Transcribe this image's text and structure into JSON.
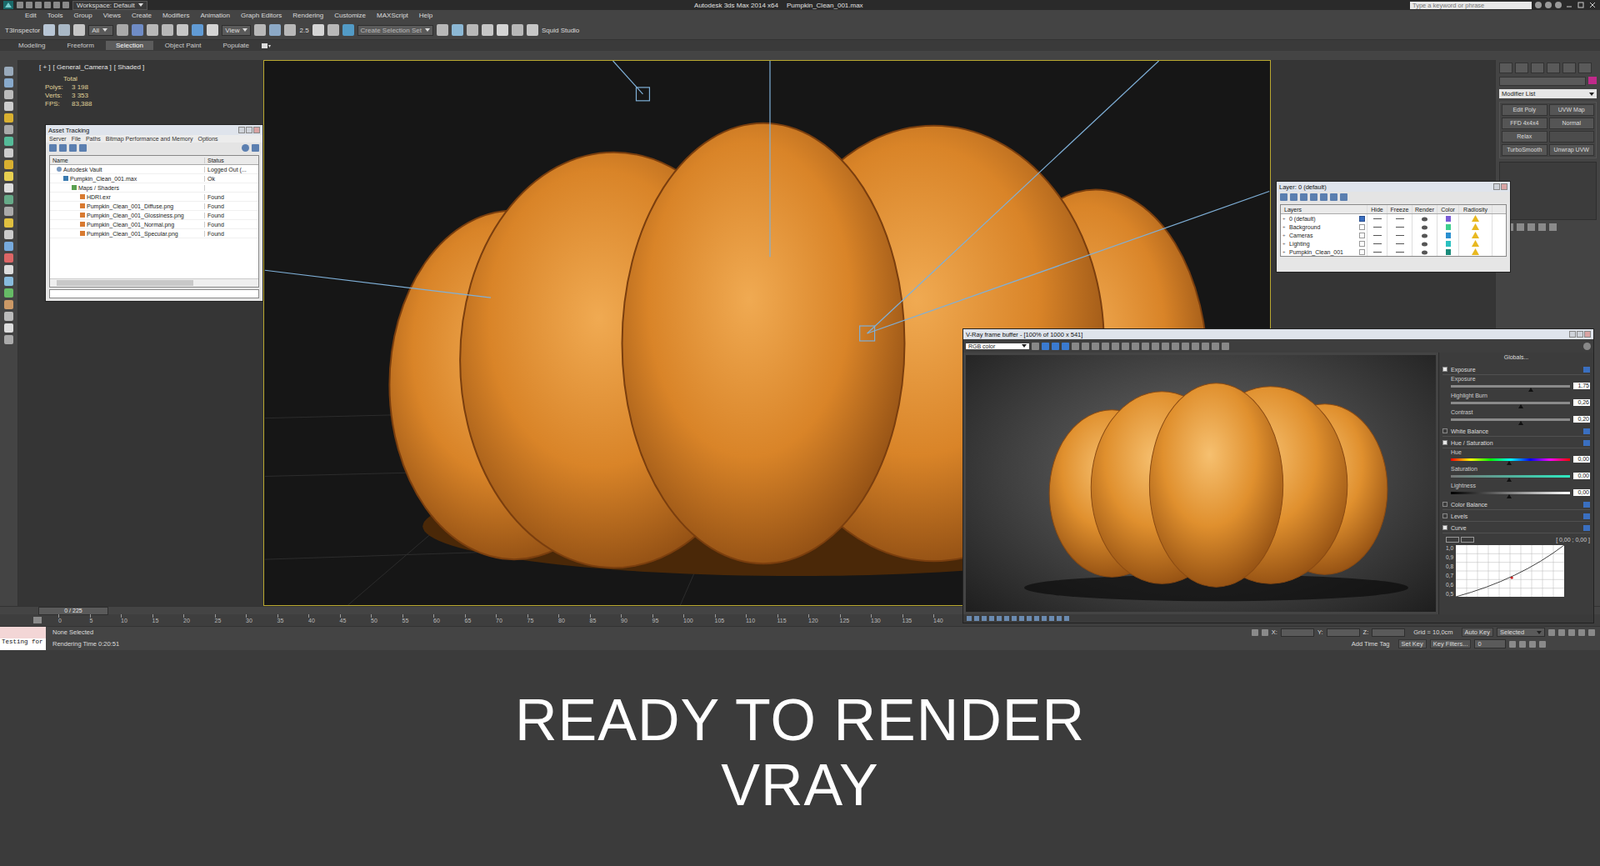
{
  "window": {
    "title": "Autodesk 3ds Max 2014 x64",
    "file": "Pumpkin_Clean_001.max",
    "workspace": "Workspace: Default",
    "search_placeholder": "Type a keyword or phrase"
  },
  "menu": [
    "Edit",
    "Tools",
    "Group",
    "Views",
    "Create",
    "Modifiers",
    "Animation",
    "Graph Editors",
    "Rendering",
    "Customize",
    "MAXScript",
    "Help"
  ],
  "toolbar": {
    "inspector": "T3Inspector",
    "filter": "All",
    "reference": "View",
    "snap": "2.5",
    "selection_set": "Create Selection Set",
    "studio": "Squid Studio"
  },
  "ribbon_tabs": [
    {
      "label": "Modeling",
      "selected": false
    },
    {
      "label": "Freeform",
      "selected": false
    },
    {
      "label": "Selection",
      "selected": true
    },
    {
      "label": "Object Paint",
      "selected": false
    },
    {
      "label": "Populate",
      "selected": false
    }
  ],
  "viewport": {
    "labels": [
      "[ + ]",
      "[ General_Camera ]",
      "[ Shaded ]"
    ],
    "stats_header": "Total",
    "stats": [
      {
        "label": "Polys:",
        "value": "3 198"
      },
      {
        "label": "Verts:",
        "value": "3 353"
      },
      {
        "label": "FPS:",
        "value": "83,388"
      }
    ]
  },
  "asset_tracking": {
    "title": "Asset Tracking",
    "menu": [
      "Server",
      "File",
      "Paths",
      "Bitmap Performance and Memory",
      "Options"
    ],
    "columns": [
      "Name",
      "Status"
    ],
    "rows": [
      {
        "name": "Autodesk Vault",
        "status": "Logged Out (...",
        "kind": "vault"
      },
      {
        "name": "Pumpkin_Clean_001.max",
        "status": "Ok",
        "kind": "file"
      },
      {
        "name": "Maps / Shaders",
        "status": "",
        "kind": "folder"
      },
      {
        "name": "HDRI.exr",
        "status": "Found",
        "kind": "map"
      },
      {
        "name": "Pumpkin_Clean_001_Diffuse.png",
        "status": "Found",
        "kind": "map"
      },
      {
        "name": "Pumpkin_Clean_001_Glossiness.png",
        "status": "Found",
        "kind": "map"
      },
      {
        "name": "Pumpkin_Clean_001_Normal.png",
        "status": "Found",
        "kind": "map"
      },
      {
        "name": "Pumpkin_Clean_001_Specular.png",
        "status": "Found",
        "kind": "map"
      }
    ]
  },
  "layers": {
    "title": "Layer: 0 (default)",
    "columns": [
      "Layers",
      "Hide",
      "Freeze",
      "Render",
      "Color",
      "Radiosity"
    ],
    "rows": [
      {
        "name": "0 (default)",
        "current": true,
        "color": "#7a5cd6"
      },
      {
        "name": "Background",
        "current": false,
        "color": "#3ecf8e"
      },
      {
        "name": "Cameras",
        "current": false,
        "color": "#2a8fd0"
      },
      {
        "name": "Lighting",
        "current": false,
        "color": "#2ac0c0"
      },
      {
        "name": "Pumpkin_Clean_001",
        "current": false,
        "color": "#1a8a7a"
      }
    ]
  },
  "command_panel": {
    "modifier_list": "Modifier List",
    "modifiers": [
      [
        "Edit Poly",
        "UVW Map"
      ],
      [
        "FFD 4x4x4",
        "Normal"
      ],
      [
        "Relax"
      ],
      [
        "TurboSmooth",
        "Unwrap UVW"
      ]
    ]
  },
  "vray": {
    "title": "V-Ray frame buffer - [100% of 1000 x 541]",
    "channel": "RGB color",
    "globals": "Globals...",
    "sections": [
      {
        "label": "Exposure",
        "checked": true,
        "sliders": [
          {
            "label": "Exposure",
            "level": 0.67,
            "value": "1,75",
            "kind": "plain"
          },
          {
            "label": "Highlight Burn",
            "level": 0.59,
            "value": "0,26",
            "kind": "plain"
          },
          {
            "label": "Contrast",
            "level": 0.59,
            "value": "0,20",
            "kind": "plain"
          }
        ]
      },
      {
        "label": "White Balance",
        "checked": false,
        "sliders": []
      },
      {
        "label": "Hue / Saturation",
        "checked": true,
        "sliders": [
          {
            "label": "Hue",
            "level": 0.49,
            "value": "0,00",
            "kind": "hue"
          },
          {
            "label": "Saturation",
            "level": 0.49,
            "value": "0,00",
            "kind": "saturation"
          },
          {
            "label": "Lightness",
            "level": 0.49,
            "value": "0,00",
            "kind": "lightness"
          }
        ]
      },
      {
        "label": "Color Balance",
        "checked": false,
        "sliders": []
      },
      {
        "label": "Levels",
        "checked": false,
        "sliders": []
      },
      {
        "label": "Curve",
        "checked": true,
        "sliders": []
      }
    ],
    "curve": {
      "readout": "[ 0,00 ; 0,00 ]",
      "ticks": [
        "1,0",
        "0,9",
        "0,8",
        "0,7",
        "0,6",
        "0,5"
      ]
    }
  },
  "timeline": {
    "slider": "0 / 225",
    "level": 0,
    "ticks": [
      "0",
      "5",
      "10",
      "15",
      "20",
      "25",
      "30",
      "35",
      "40",
      "45",
      "50",
      "55",
      "60",
      "65",
      "70",
      "75",
      "80",
      "85",
      "90",
      "95",
      "100",
      "105",
      "110",
      "115",
      "120",
      "125",
      "130",
      "135",
      "140"
    ]
  },
  "status_bar": {
    "listener": "Testing for",
    "selection": "None Selected",
    "render_time": "Rendering Time  0:20:51",
    "coords": [
      "X:",
      "Y:",
      "Z:"
    ],
    "grid": "Grid = 10,0cm",
    "time_tag": "Add Time Tag",
    "auto_key": "Auto Key",
    "key_mode": "Selected",
    "set_key": "Set Key",
    "key_filters": "Key Filters...",
    "frame": "0"
  },
  "caption": {
    "lines": [
      "READY TO RENDER",
      "VRAY"
    ]
  }
}
